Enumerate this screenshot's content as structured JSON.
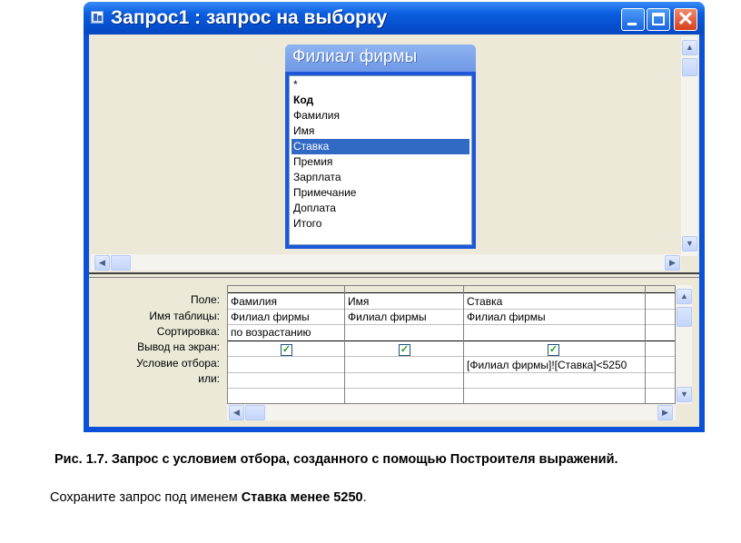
{
  "window": {
    "title": "Запрос1 : запрос на выборку",
    "buttons": {
      "minimize": "minimize",
      "maximize": "maximize",
      "close": "✕"
    }
  },
  "field_list": {
    "title": "Филиал фирмы",
    "items": [
      "*",
      "Код",
      "Фамилия",
      "Имя",
      "Ставка",
      "Премия",
      "Зарплата",
      "Примечание",
      "Доплата",
      "Итого"
    ],
    "selected": "Ставка"
  },
  "grid": {
    "row_labels": [
      "Поле:",
      "Имя таблицы:",
      "Сортировка:",
      "Вывод на экран:",
      "Условие отбора:",
      "или:"
    ],
    "columns": [
      {
        "field": "Фамилия",
        "table": "Филиал фирмы",
        "sort": "по возрастанию",
        "show": true,
        "criteria": "",
        "or": ""
      },
      {
        "field": "Имя",
        "table": "Филиал фирмы",
        "sort": "",
        "show": true,
        "criteria": "",
        "or": ""
      },
      {
        "field": "Ставка",
        "table": "Филиал фирмы",
        "sort": "",
        "show": true,
        "criteria": "[Филиал фирмы]![Ставка]<5250",
        "or": ""
      }
    ]
  },
  "caption": "Рис. 1.7. Запрос с условием отбора, созданного с помощью Построителя выражений.",
  "instruction": {
    "prefix": "Сохраните запрос под именем ",
    "name": "Ставка менее 5250",
    "suffix": "."
  }
}
